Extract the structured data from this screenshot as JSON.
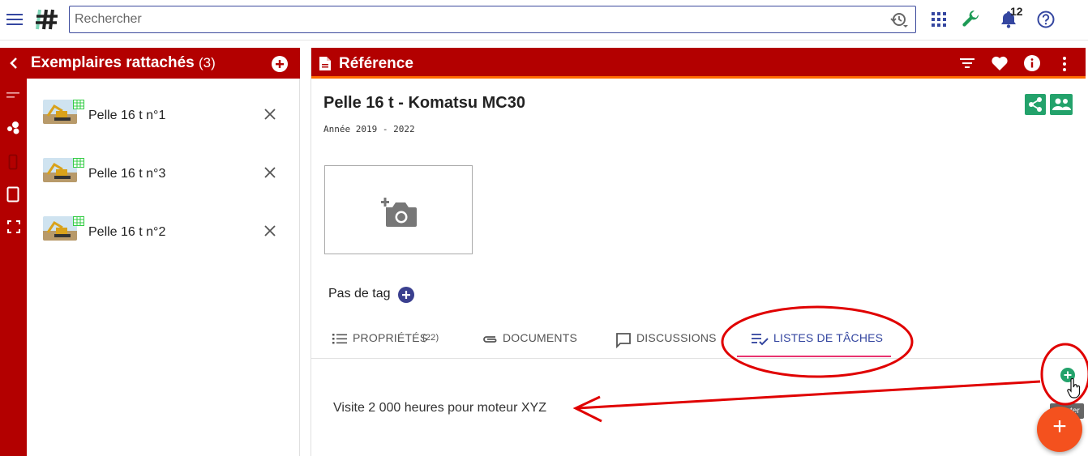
{
  "topbar": {
    "menu_icon": "hamburger-icon",
    "logo_icon": "app-logo-icon",
    "search": {
      "placeholder": "Rechercher",
      "value": "",
      "history_icon": "search-history-icon"
    },
    "apps_icon": "apps-grid-icon",
    "tools_icon": "wrench-icon",
    "notifications": {
      "icon": "bell-icon",
      "count": "12"
    },
    "help_icon": "help-icon"
  },
  "rail": {
    "icons": [
      "collapse-chevron-icon",
      "filter-lines-icon",
      "bubbles-icon",
      "phone-icon",
      "tablet-icon",
      "fullscreen-icon"
    ]
  },
  "left_panel": {
    "title": "Exemplaires rattachés",
    "count": "(3)",
    "add_icon": "add-circle-icon",
    "items": [
      {
        "label": "Pelle 16 t n°1"
      },
      {
        "label": "Pelle 16 t n°3"
      },
      {
        "label": "Pelle 16 t n°2"
      }
    ]
  },
  "right_panel": {
    "header_title": "Référence",
    "header_icons": [
      "document-icon",
      "filter-icon",
      "heart-icon",
      "info-icon",
      "more-vert-icon"
    ],
    "title": "Pelle 16 t - Komatsu MC30",
    "subtitle": "Année 2019 - 2022",
    "actions": [
      "share-icon",
      "people-icon"
    ],
    "photo_placeholder_icon": "add-photo-icon",
    "tags": {
      "label": "Pas de tag",
      "add_icon": "add-circle-icon"
    },
    "tabs": [
      {
        "label": "PROPRIÉTÉS",
        "count": "(22)",
        "icon": "list-icon"
      },
      {
        "label": "DOCUMENTS",
        "icon": "paperclip-icon"
      },
      {
        "label": "DISCUSSIONS",
        "icon": "chat-icon"
      },
      {
        "label": "LISTES DE TÂCHES",
        "icon": "checklist-icon",
        "active": true
      }
    ],
    "task_lists": [
      {
        "label": "Visite 2 000 heures pour moteur XYZ"
      }
    ]
  },
  "add_button": {
    "tooltip": "Ajouter",
    "icon": "add-circle-green-icon"
  },
  "fab": {
    "label": "+"
  },
  "colors": {
    "brand_red": "#b30000",
    "accent_orange": "#f4511e",
    "active_tab": "#3446a0",
    "annotation_red": "#e00000",
    "success_green": "#23a26b"
  }
}
